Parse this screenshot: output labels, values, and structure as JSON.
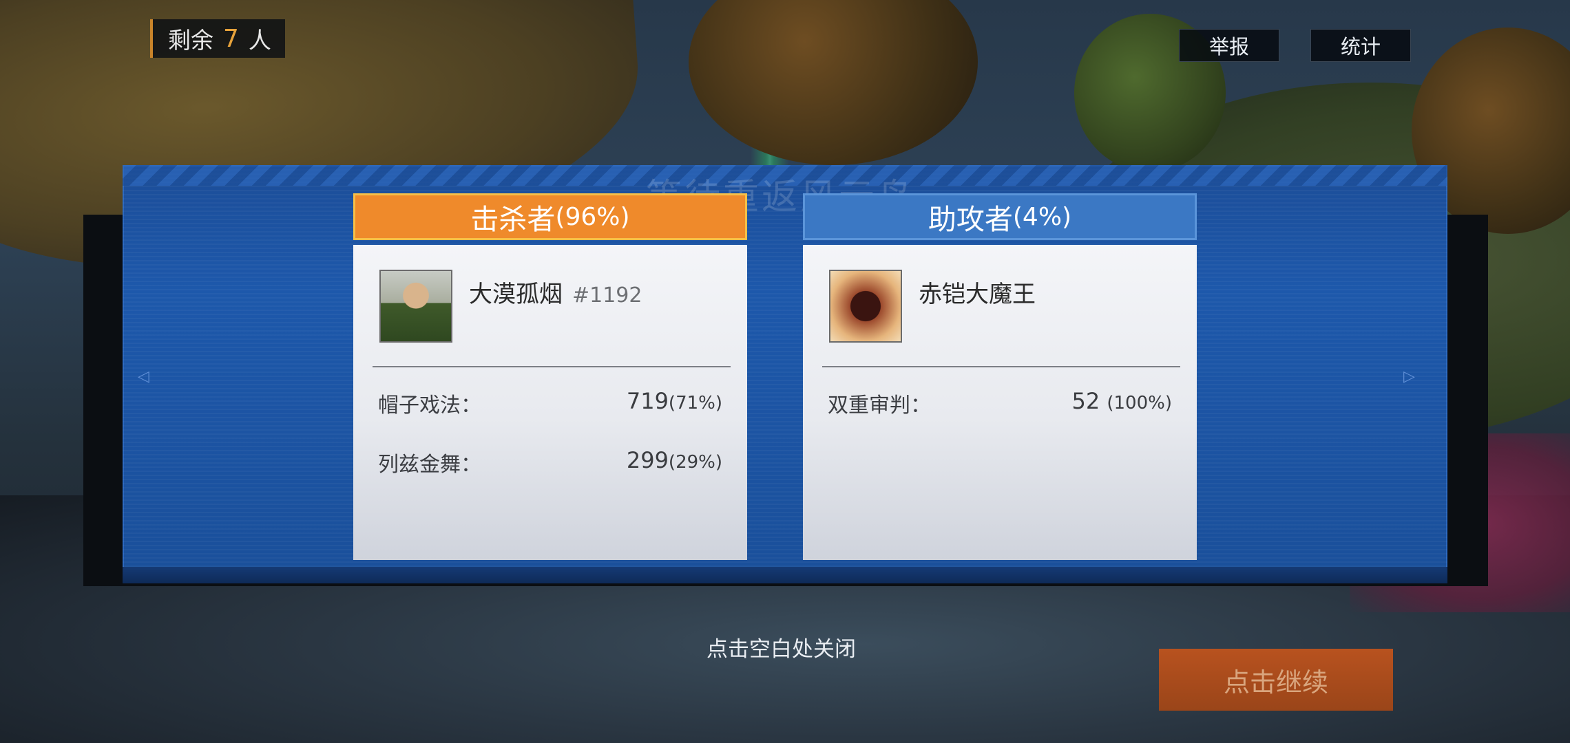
{
  "hud": {
    "remaining_prefix": "剩余",
    "remaining_count": "7",
    "remaining_suffix": "人",
    "report_label": "举报",
    "stats_label": "统计"
  },
  "panel": {
    "ghost_title": "等待重返风云岛..."
  },
  "killer": {
    "header_label": "击杀者",
    "header_pct": "(96%)",
    "player_name": "大漠孤烟",
    "player_id": "#1192",
    "skills": [
      {
        "name": "帽子戏法：",
        "value": "719",
        "pct": "(71%)"
      },
      {
        "name": "列兹金舞：",
        "value": "299",
        "pct": "(29%)"
      }
    ]
  },
  "assist": {
    "header_label": "助攻者",
    "header_pct": "(4%)",
    "player_name": "赤铠大魔王",
    "skills": [
      {
        "name": "双重审判：",
        "value": "52",
        "pct": "(100%)"
      }
    ]
  },
  "footer": {
    "close_hint": "点击空白处关闭",
    "continue_label": "点击继续"
  },
  "colors": {
    "killer_accent": "#ef8a2b",
    "assist_accent": "#3b78c4",
    "panel_blue": "#1d58ab",
    "continue_button": "#b8521f"
  }
}
